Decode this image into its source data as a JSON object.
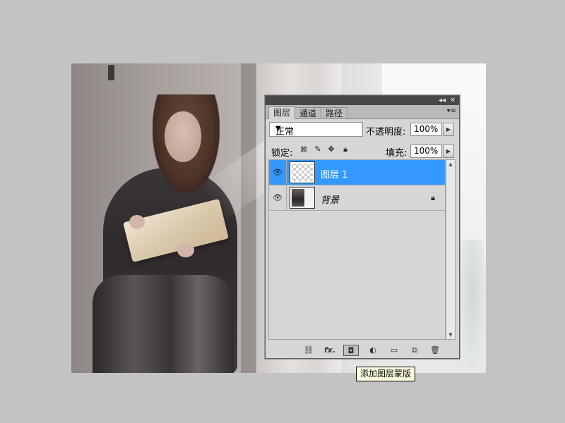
{
  "panel": {
    "titlebar": {
      "collapse_icon": "◂◂",
      "close_icon": "✕"
    },
    "tabs": [
      {
        "label": "图层",
        "active": true
      },
      {
        "label": "通道",
        "active": false
      },
      {
        "label": "路径",
        "active": false
      }
    ],
    "menu_icon": "▾≡",
    "blend_mode": "正常",
    "opacity_label": "不透明度:",
    "opacity_value": "100%",
    "lock_label": "锁定:",
    "fill_label": "填充:",
    "fill_value": "100%",
    "layers": [
      {
        "name": "图层 1",
        "selected": true,
        "visible": true,
        "locked": false
      },
      {
        "name": "背景",
        "selected": false,
        "visible": true,
        "locked": true
      }
    ],
    "bottom_buttons": [
      "link-layers",
      "fx",
      "add-layer-mask",
      "adjustment-layer",
      "new-group",
      "new-layer",
      "delete-layer"
    ],
    "fx_label": "fx."
  },
  "tooltip": {
    "text": "添加图层蒙版"
  },
  "colors": {
    "selection": "#3399ff",
    "panel_bg": "#d6d6d6",
    "app_bg": "#c3c3c3"
  }
}
